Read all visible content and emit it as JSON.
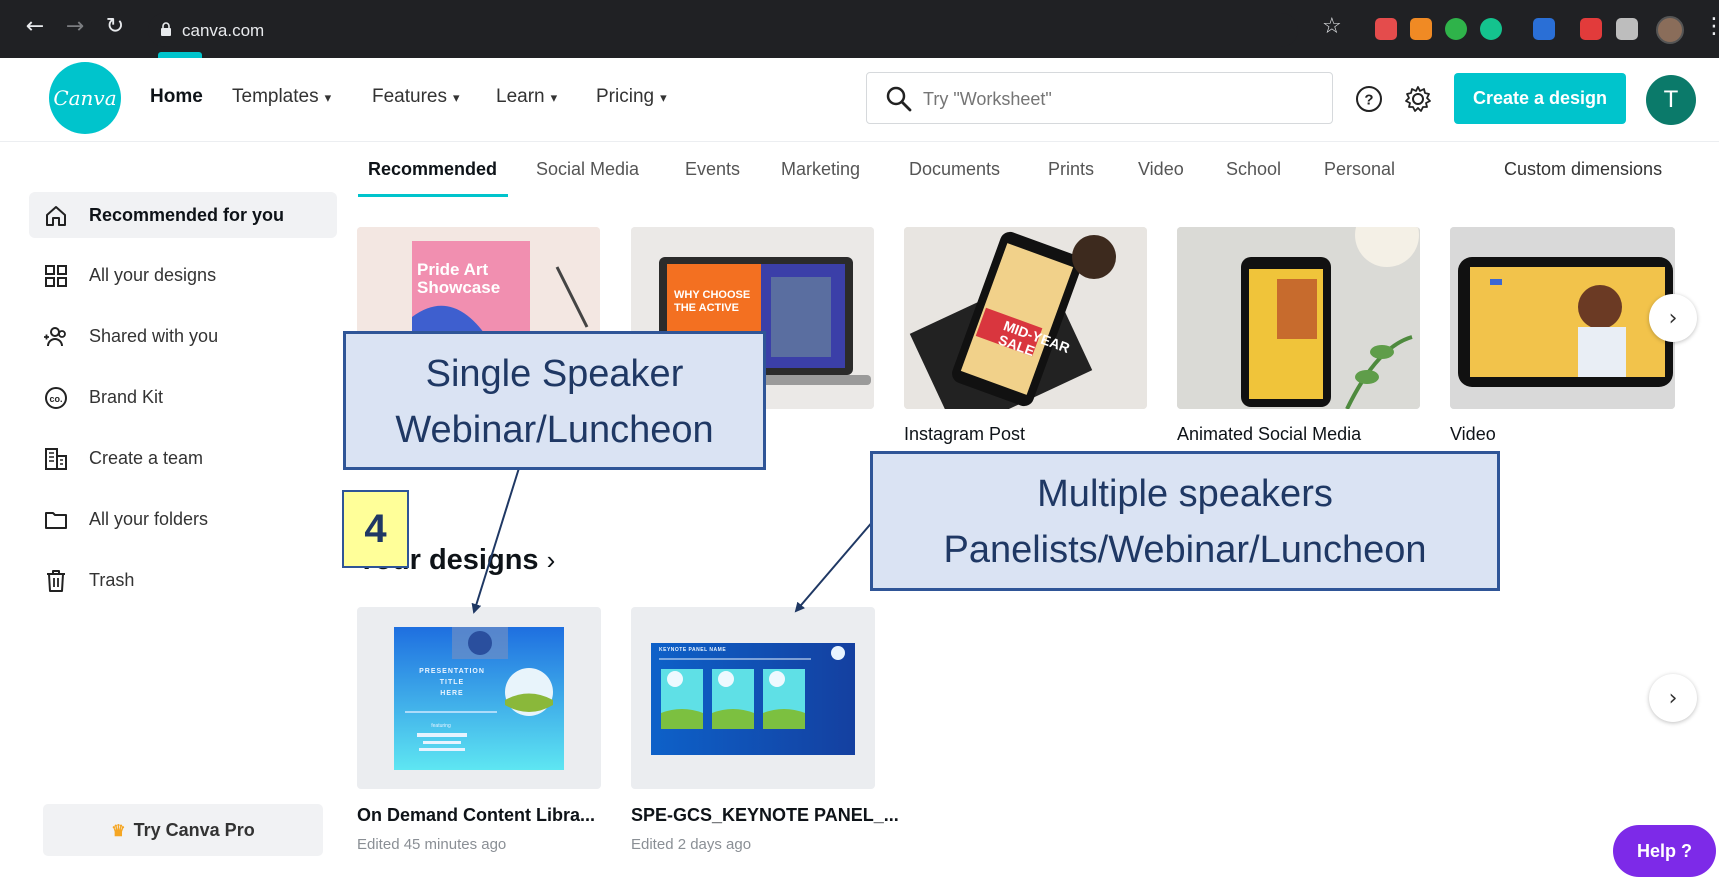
{
  "browser": {
    "url": "canva.com"
  },
  "header": {
    "logo_text": "Canva",
    "nav": [
      {
        "label": "Home",
        "active": true,
        "dropdown": false
      },
      {
        "label": "Templates",
        "active": false,
        "dropdown": true
      },
      {
        "label": "Features",
        "active": false,
        "dropdown": true
      },
      {
        "label": "Learn",
        "active": false,
        "dropdown": true
      },
      {
        "label": "Pricing",
        "active": false,
        "dropdown": true
      }
    ],
    "search_placeholder": "Try \"Worksheet\"",
    "create_label": "Create a design",
    "avatar_initial": "T"
  },
  "sidebar": {
    "items": [
      {
        "label": "Recommended for you",
        "icon": "home-icon",
        "active": true
      },
      {
        "label": "All your designs",
        "icon": "grid-icon",
        "active": false
      },
      {
        "label": "Shared with you",
        "icon": "people-icon",
        "active": false
      },
      {
        "label": "Brand Kit",
        "icon": "brand-kit-icon",
        "active": false
      },
      {
        "label": "Create a team",
        "icon": "building-icon",
        "active": false
      },
      {
        "label": "All your folders",
        "icon": "folder-icon",
        "active": false
      },
      {
        "label": "Trash",
        "icon": "trash-icon",
        "active": false
      }
    ],
    "try_pro_label": "Try Canva Pro"
  },
  "tabs": {
    "items": [
      "Recommended",
      "Social Media",
      "Events",
      "Marketing",
      "Documents",
      "Prints",
      "Video",
      "School",
      "Personal"
    ],
    "active_index": 0,
    "custom_label": "Custom dimensions"
  },
  "templates": {
    "card1_text": "Pride Art Showcase",
    "card2_text": "WHY CHOOSE THE ACTIVE",
    "card3_text": "MID-YEAR SALE",
    "labels": [
      "Instagram Post",
      "Animated Social Media",
      "Video"
    ]
  },
  "designs": {
    "section_title": "Your designs",
    "section_chevron": "›",
    "items": [
      {
        "title": "On Demand Content Libra...",
        "edited": "Edited 45 minutes ago",
        "thumb_title_1": "PRESENTATION",
        "thumb_title_2": "TITLE",
        "thumb_title_3": "HERE"
      },
      {
        "title": "SPE-GCS_KEYNOTE PANEL_...",
        "edited": "Edited 2 days ago",
        "thumb_header": "KEYNOTE PANEL NAME"
      }
    ]
  },
  "help_label": "Help ?",
  "callouts": {
    "single": [
      "Single Speaker",
      "Webinar/Luncheon"
    ],
    "multiple": [
      "Multiple speakers",
      "Panelists/Webinar/Luncheon"
    ],
    "badge": "4"
  },
  "colors": {
    "brand": "#00c4cc",
    "help": "#7d2ae8",
    "callout_fill": "#dae3f3",
    "callout_border": "#2f5597",
    "badge_fill": "#ffff99"
  }
}
